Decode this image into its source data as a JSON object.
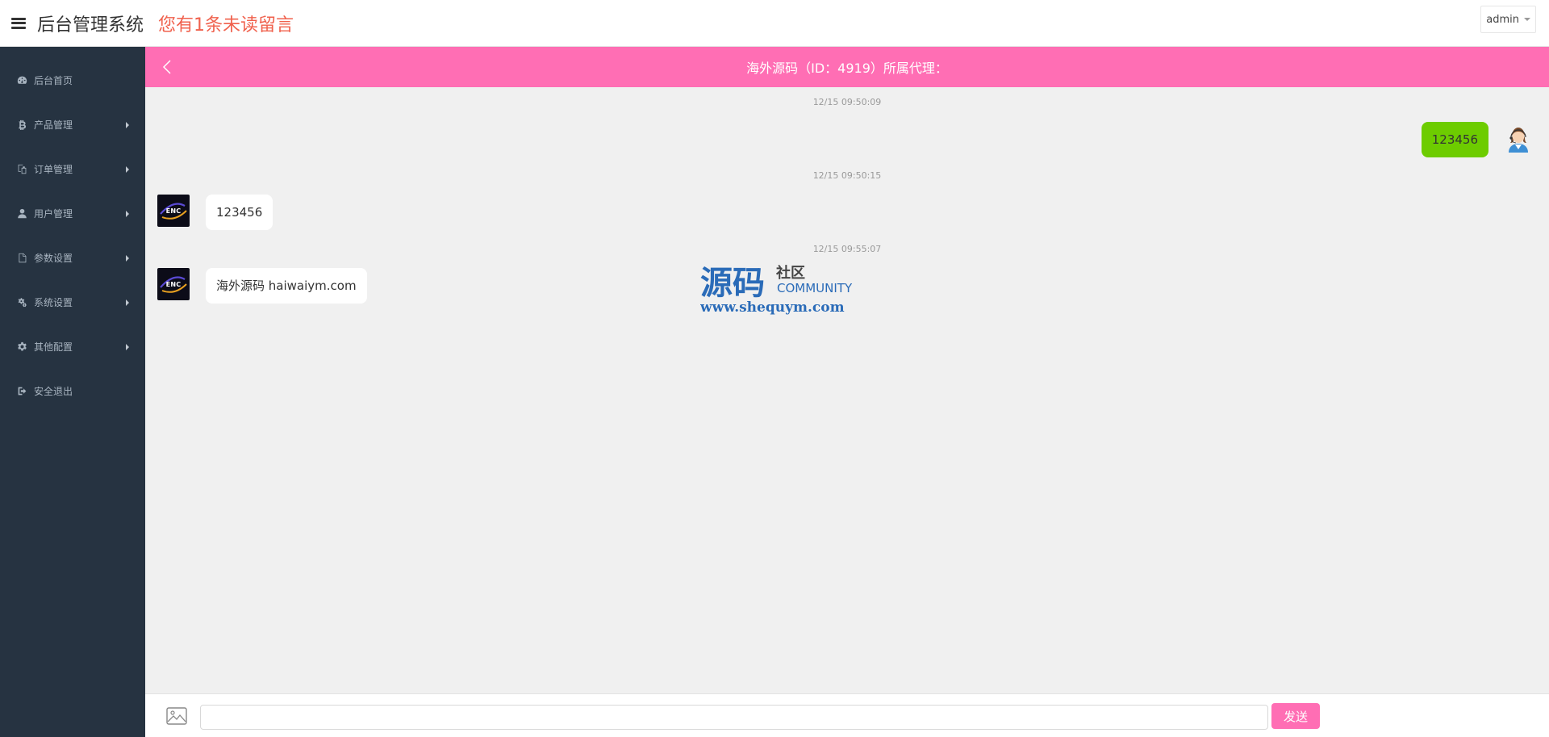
{
  "header": {
    "title": "后台管理系统",
    "unread_notice": "您有1条未读留言",
    "user": "admin"
  },
  "sidebar": {
    "items": [
      {
        "label": "后台首页",
        "icon": "dashboard-icon",
        "has_submenu": false
      },
      {
        "label": "产品管理",
        "icon": "bitcoin-icon",
        "has_submenu": true
      },
      {
        "label": "订单管理",
        "icon": "copy-icon",
        "has_submenu": true
      },
      {
        "label": "用户管理",
        "icon": "user-icon",
        "has_submenu": true
      },
      {
        "label": "参数设置",
        "icon": "file-icon",
        "has_submenu": true
      },
      {
        "label": "系统设置",
        "icon": "gears-icon",
        "has_submenu": true
      },
      {
        "label": "其他配置",
        "icon": "gear-icon",
        "has_submenu": true
      },
      {
        "label": "安全退出",
        "icon": "sign-out-icon",
        "has_submenu": false
      }
    ]
  },
  "chat": {
    "title": "海外源码（ID：4919）所属代理：",
    "messages": [
      {
        "time": "12/15 09:50:09",
        "text": "123456",
        "from": "agent"
      },
      {
        "time": "12/15 09:50:15",
        "text": "123456",
        "from": "user"
      },
      {
        "time": "12/15 09:55:07",
        "text": "海外源码 haiwaiym.com",
        "from": "user"
      }
    ],
    "user_avatar_text": "ENC"
  },
  "watermark": {
    "title": "源码",
    "subtitle": "社区",
    "community": "COMMUNITY",
    "url": "www.shequym.com"
  },
  "input": {
    "value": "",
    "placeholder": "",
    "send_label": "发送"
  },
  "colors": {
    "accent_pink": "#ff6eb4",
    "sidebar_bg": "#263341",
    "own_bubble": "#6dcc00",
    "notice_red": "#f0614d"
  }
}
